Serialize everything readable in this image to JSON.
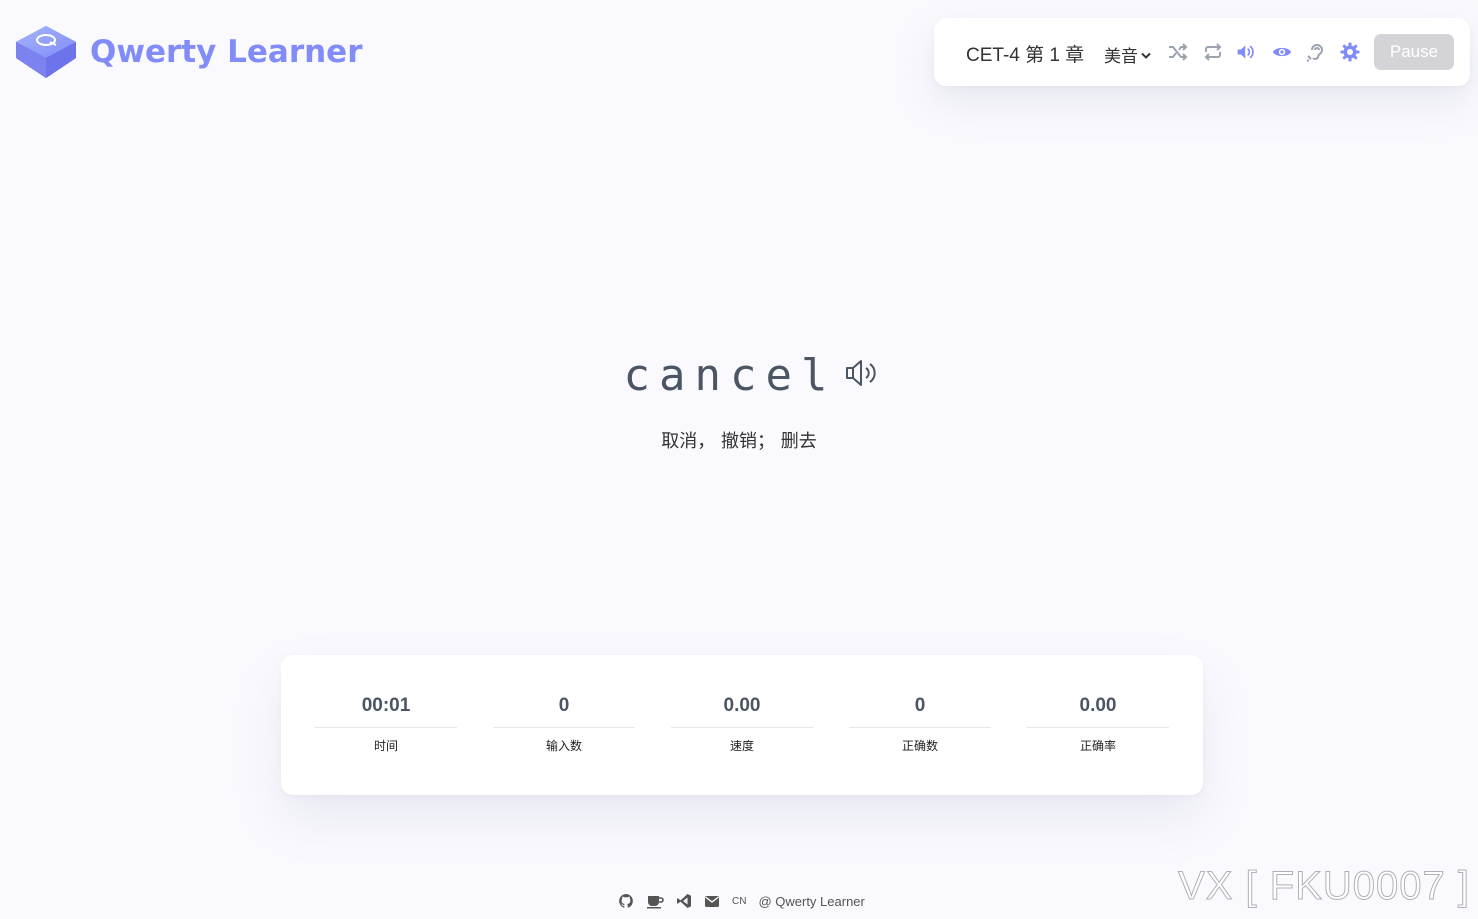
{
  "app": {
    "name": "Qwerty Learner",
    "logo_letter": "Q"
  },
  "toolbar": {
    "dictionary_label": "CET-4 第 1 章",
    "accent_label": "美音",
    "pause_label": "Pause",
    "icons": [
      "shuffle-icon",
      "repeat-icon",
      "sound-icon",
      "eye-icon",
      "hearing-icon",
      "settings-icon"
    ]
  },
  "word": {
    "text": "cancel",
    "translation": "取消，  撤销；  删去"
  },
  "stats": [
    {
      "value": "00:01",
      "label": "时间"
    },
    {
      "value": "0",
      "label": "输入数"
    },
    {
      "value": "0.00",
      "label": "速度"
    },
    {
      "value": "0",
      "label": "正确数"
    },
    {
      "value": "0.00",
      "label": "正确率"
    }
  ],
  "footer": {
    "lang": "CN",
    "copyright": "@ Qwerty Learner"
  },
  "watermark": "VX [ FKU0007 ]",
  "colors": {
    "accent": "#818cf8",
    "background": "#f9f9fe",
    "button_disabled": "#d4d4d8"
  }
}
